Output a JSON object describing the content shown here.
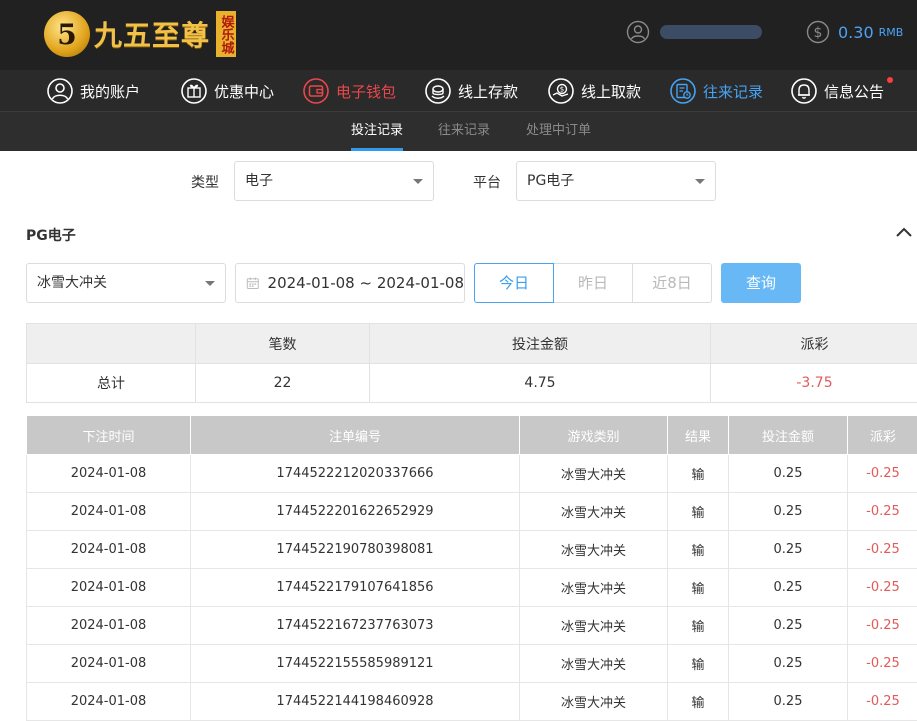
{
  "brand": {
    "badge": "5",
    "name": "九五至尊",
    "stamp": "娱乐城"
  },
  "account": {
    "balance": "0.30",
    "currency": "RMB"
  },
  "nav": [
    {
      "label": "我的账户",
      "icon": "user-circle-icon",
      "state": "normal"
    },
    {
      "label": "优惠中心",
      "icon": "gift-icon",
      "state": "normal"
    },
    {
      "label": "电子钱包",
      "icon": "wallet-icon",
      "state": "red"
    },
    {
      "label": "线上存款",
      "icon": "deposit-icon",
      "state": "normal"
    },
    {
      "label": "线上取款",
      "icon": "withdraw-icon",
      "state": "normal"
    },
    {
      "label": "往来记录",
      "icon": "records-icon",
      "state": "active"
    },
    {
      "label": "信息公告",
      "icon": "bell-icon",
      "state": "normal"
    }
  ],
  "subtabs": [
    "投注记录",
    "往来记录",
    "处理中订单"
  ],
  "filters": {
    "type_label": "类型",
    "type_value": "电子",
    "platform_label": "平台",
    "platform_value": "PG电子",
    "section_title": "PG电子",
    "game_value": "冰雪大冲关",
    "date_range": "2024-01-08 ~ 2024-01-08",
    "quick": [
      "今日",
      "昨日",
      "近8日"
    ],
    "query_label": "查询"
  },
  "summary": {
    "headers": [
      "",
      "笔数",
      "投注金额",
      "派彩"
    ],
    "row": [
      "总计",
      "22",
      "4.75",
      "-3.75"
    ]
  },
  "records": {
    "headers": [
      "下注时间",
      "注单编号",
      "游戏类别",
      "结果",
      "投注金额",
      "派彩"
    ],
    "rows": [
      [
        "2024-01-08",
        "1744522212020337666",
        "冰雪大冲关",
        "输",
        "0.25",
        "-0.25"
      ],
      [
        "2024-01-08",
        "1744522201622652929",
        "冰雪大冲关",
        "输",
        "0.25",
        "-0.25"
      ],
      [
        "2024-01-08",
        "1744522190780398081",
        "冰雪大冲关",
        "输",
        "0.25",
        "-0.25"
      ],
      [
        "2024-01-08",
        "1744522179107641856",
        "冰雪大冲关",
        "输",
        "0.25",
        "-0.25"
      ],
      [
        "2024-01-08",
        "1744522167237763073",
        "冰雪大冲关",
        "输",
        "0.25",
        "-0.25"
      ],
      [
        "2024-01-08",
        "1744522155585989121",
        "冰雪大冲关",
        "输",
        "0.25",
        "-0.25"
      ],
      [
        "2024-01-08",
        "1744522144198460928",
        "冰雪大冲关",
        "输",
        "0.25",
        "-0.25"
      ]
    ]
  },
  "colors": {
    "accent": "#2f9bf0",
    "negative": "#e25a5a",
    "wallet": "#e8474b",
    "gold": "#f2c14a"
  }
}
